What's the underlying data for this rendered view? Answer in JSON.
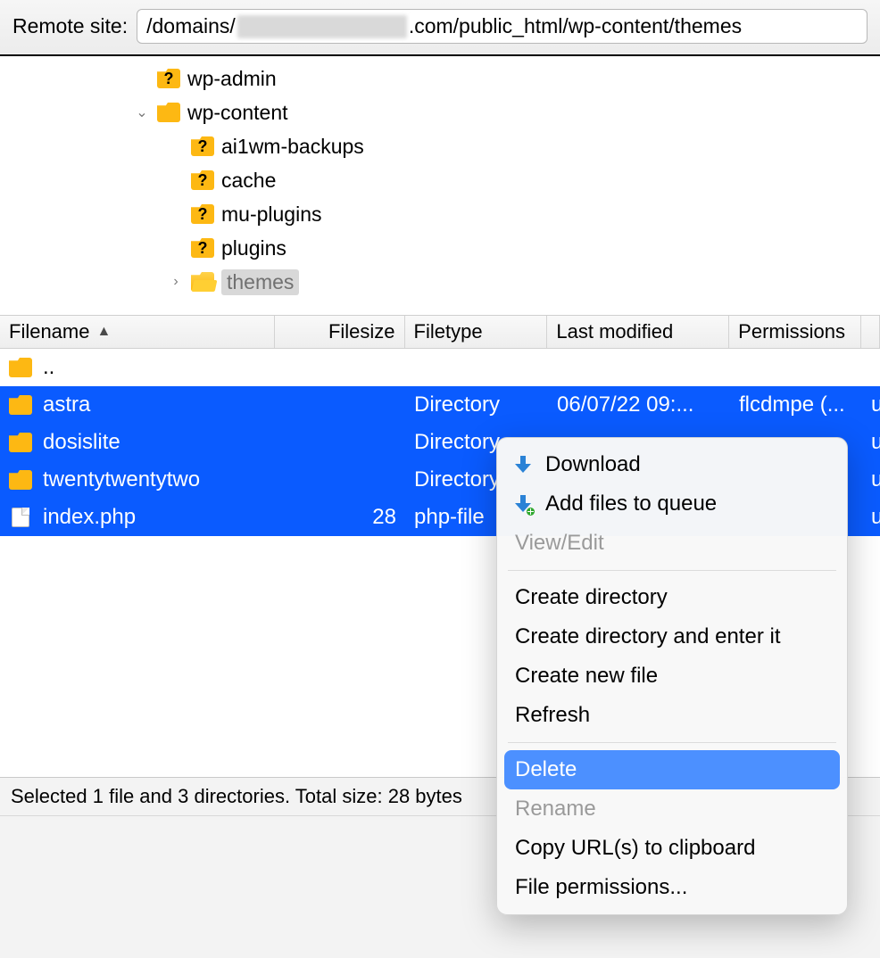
{
  "address": {
    "label": "Remote site:",
    "path_prefix": "/domains/",
    "path_suffix": ".com/public_html/wp-content/themes"
  },
  "tree": {
    "items": [
      {
        "indent": 180,
        "icon": "q",
        "label": "wp-admin",
        "expander": ""
      },
      {
        "indent": 180,
        "icon": "folder",
        "label": "wp-content",
        "expander": "down"
      },
      {
        "indent": 218,
        "icon": "q",
        "label": "ai1wm-backups",
        "expander": ""
      },
      {
        "indent": 218,
        "icon": "q",
        "label": "cache",
        "expander": ""
      },
      {
        "indent": 218,
        "icon": "q",
        "label": "mu-plugins",
        "expander": ""
      },
      {
        "indent": 218,
        "icon": "q",
        "label": "plugins",
        "expander": ""
      },
      {
        "indent": 218,
        "icon": "open",
        "label": "themes",
        "expander": "right",
        "selected": true
      }
    ]
  },
  "columns": {
    "name": "Filename",
    "size": "Filesize",
    "type": "Filetype",
    "modified": "Last modified",
    "permissions": "Permissions",
    "owner": ""
  },
  "rows": [
    {
      "icon": "folder",
      "name": "..",
      "size": "",
      "type": "",
      "modified": "",
      "perm": "",
      "own": "",
      "sel": false
    },
    {
      "icon": "folder",
      "name": "astra",
      "size": "",
      "type": "Directory",
      "modified": "06/07/22 09:...",
      "perm": "flcdmpe (...",
      "own": "u",
      "sel": true
    },
    {
      "icon": "folder",
      "name": "dosislite",
      "size": "",
      "type": "Directory",
      "modified": "",
      "perm": "",
      "own": "u",
      "sel": true
    },
    {
      "icon": "folder",
      "name": "twentytwentytwo",
      "size": "",
      "type": "Directory",
      "modified": "",
      "perm": "",
      "own": "u",
      "sel": true
    },
    {
      "icon": "file",
      "name": "index.php",
      "size": "28",
      "type": "php-file",
      "modified": "",
      "perm": "",
      "own": "u",
      "sel": true
    }
  ],
  "status": "Selected 1 file and 3 directories. Total size: 28 bytes",
  "menu": {
    "download": "Download",
    "add_queue": "Add files to queue",
    "view_edit": "View/Edit",
    "create_dir": "Create directory",
    "create_dir_enter": "Create directory and enter it",
    "create_file": "Create new file",
    "refresh": "Refresh",
    "delete": "Delete",
    "rename": "Rename",
    "copy_url": "Copy URL(s) to clipboard",
    "file_perm": "File permissions..."
  }
}
